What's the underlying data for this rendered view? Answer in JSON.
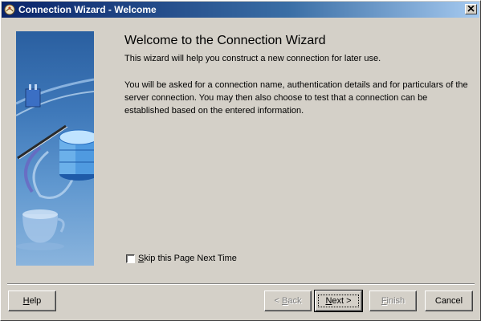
{
  "window": {
    "title": "Connection Wizard - Welcome",
    "close_label": "x"
  },
  "content": {
    "heading": "Welcome to the Connection Wizard",
    "intro": "This wizard will help you construct a new connection for later use.",
    "details": "You will be asked for a connection name, authentication details and for particulars of the server connection. You may then also choose to test that a connection can be established based on the entered information."
  },
  "skip_checkbox": {
    "label_underlined": "S",
    "label_rest": "kip this Page Next Time",
    "checked": false
  },
  "buttons": {
    "help": {
      "u": "H",
      "rest": "elp"
    },
    "back": {
      "pre": "< ",
      "u": "B",
      "rest": "ack"
    },
    "next": {
      "u": "N",
      "rest": "ext >"
    },
    "finish": {
      "u": "F",
      "rest": "inish"
    },
    "cancel": "Cancel"
  },
  "icons": {
    "title_icon": "wizard-app-icon",
    "close_icon": "close-icon",
    "illustration": "database-connection-illustration"
  },
  "colors": {
    "titlebar_start": "#0a246a",
    "titlebar_end": "#a6caf0",
    "dialog_bg": "#d4d0c8"
  }
}
